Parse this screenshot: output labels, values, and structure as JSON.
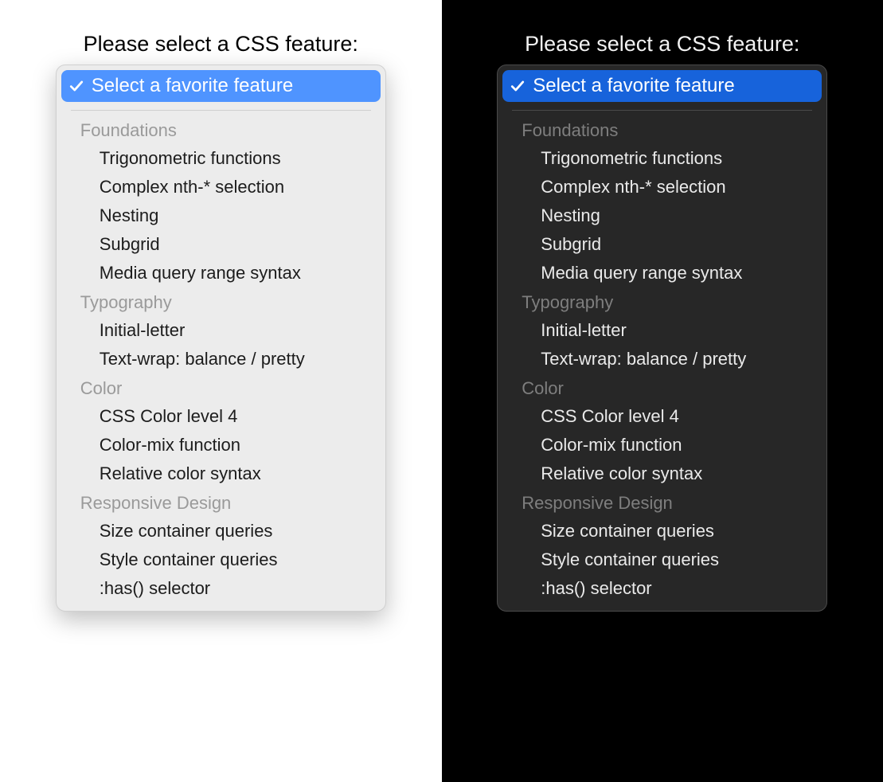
{
  "colors": {
    "light_bg": "#ffffff",
    "dark_bg": "#000000",
    "light_panel": "#ececec",
    "dark_panel": "#272727",
    "light_accent": "#4f94ff",
    "dark_accent": "#1763db"
  },
  "prompt": "Please select a CSS feature:",
  "selected_label": "Select a favorite feature",
  "check_icon_name": "checkmark-icon",
  "groups": [
    {
      "title": "Foundations",
      "items": [
        "Trigonometric functions",
        "Complex nth-* selection",
        "Nesting",
        "Subgrid",
        "Media query range syntax"
      ]
    },
    {
      "title": "Typography",
      "items": [
        "Initial-letter",
        "Text-wrap: balance / pretty"
      ]
    },
    {
      "title": "Color",
      "items": [
        "CSS Color level 4",
        "Color-mix function",
        "Relative color syntax"
      ]
    },
    {
      "title": "Responsive Design",
      "items": [
        "Size container queries",
        "Style container queries",
        ":has() selector"
      ]
    }
  ]
}
